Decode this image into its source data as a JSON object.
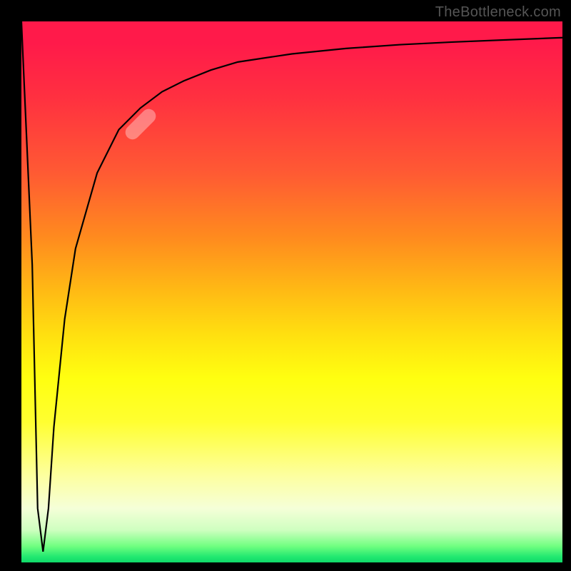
{
  "watermark": "TheBottleneck.com",
  "colors": {
    "frame": "#000000",
    "curve": "#000000",
    "highlight": "rgba(255,255,255,0.35)"
  },
  "chart_data": {
    "type": "line",
    "title": "",
    "xlabel": "",
    "ylabel": "",
    "xlim": [
      0,
      100
    ],
    "ylim": [
      0,
      100
    ],
    "grid": false,
    "legend": false,
    "series": [
      {
        "name": "bottleneck-curve",
        "x": [
          0,
          2,
          3,
          4,
          5,
          6,
          8,
          10,
          14,
          18,
          22,
          26,
          30,
          35,
          40,
          50,
          60,
          70,
          80,
          90,
          100
        ],
        "y": [
          100,
          55,
          10,
          2,
          10,
          25,
          45,
          58,
          72,
          80,
          84,
          87,
          89,
          91,
          92.5,
          94,
          95,
          95.7,
          96.2,
          96.6,
          97
        ]
      }
    ],
    "annotations": [
      {
        "type": "highlight-segment",
        "x": 22,
        "y": 81,
        "angle": -45
      }
    ]
  }
}
